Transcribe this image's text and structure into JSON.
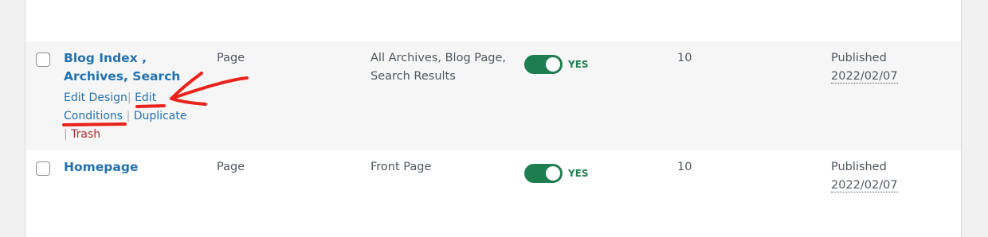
{
  "rows": [
    {
      "title": "Blog Index , Archives, Search",
      "type": "Page",
      "conditions": "All Archives, Blog Page, Search Results",
      "status_toggle": "YES",
      "priority": "10",
      "status": "Published",
      "date": "2022/02/07",
      "actions": {
        "edit_design": "Edit Design",
        "edit_conditions": "Edit Conditions",
        "duplicate": "Duplicate",
        "trash": "Trash",
        "separator": "|"
      }
    },
    {
      "title": "Homepage",
      "type": "Page",
      "conditions": "Front Page",
      "status_toggle": "YES",
      "priority": "10",
      "status": "Published",
      "date": "2022/02/07"
    }
  ],
  "colors": {
    "link": "#2271b1",
    "toggle_on": "#1e7e4f",
    "trash": "#b32d2e",
    "annotation": "#e8231b"
  }
}
